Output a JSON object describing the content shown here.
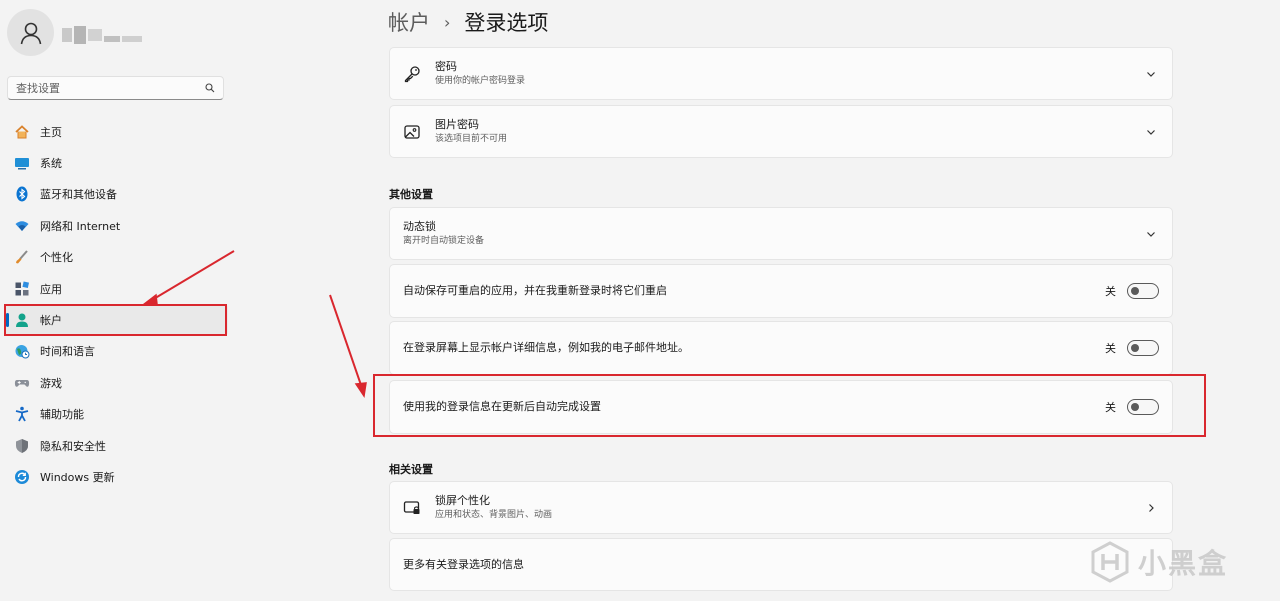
{
  "sidebar": {
    "search": {
      "placeholder": "查找设置"
    },
    "items": [
      {
        "label": "主页",
        "icon": "home-icon"
      },
      {
        "label": "系统",
        "icon": "system-icon"
      },
      {
        "label": "蓝牙和其他设备",
        "icon": "bluetooth-icon"
      },
      {
        "label": "网络和 Internet",
        "icon": "wifi-icon"
      },
      {
        "label": "个性化",
        "icon": "brush-icon"
      },
      {
        "label": "应用",
        "icon": "apps-icon"
      },
      {
        "label": "帐户",
        "icon": "account-icon",
        "active": true
      },
      {
        "label": "时间和语言",
        "icon": "globe-clock-icon"
      },
      {
        "label": "游戏",
        "icon": "gamepad-icon"
      },
      {
        "label": "辅助功能",
        "icon": "accessibility-icon"
      },
      {
        "label": "隐私和安全性",
        "icon": "shield-icon"
      },
      {
        "label": "Windows 更新",
        "icon": "update-icon"
      }
    ]
  },
  "breadcrumb": {
    "parent": "帐户",
    "current": "登录选项"
  },
  "cards": {
    "password": {
      "title": "密码",
      "subtitle": "使用你的帐户密码登录"
    },
    "picture_password": {
      "title": "图片密码",
      "subtitle": "该选项目前不可用"
    }
  },
  "other_settings": {
    "header": "其他设置",
    "dynamic_lock": {
      "title": "动态锁",
      "subtitle": "离开时自动锁定设备"
    },
    "toggles": [
      {
        "label": "自动保存可重启的应用，并在我重新登录时将它们重启",
        "state": "关"
      },
      {
        "label": "在登录屏幕上显示帐户详细信息，例如我的电子邮件地址。",
        "state": "关"
      },
      {
        "label": "使用我的登录信息在更新后自动完成设置",
        "state": "关"
      }
    ]
  },
  "related_settings": {
    "header": "相关设置",
    "lock_screen": {
      "title": "锁屏个性化",
      "subtitle": "应用和状态、背景图片、动画"
    },
    "more_info": {
      "title": "更多有关登录选项的信息"
    }
  },
  "watermark": {
    "text": "小黑盒"
  },
  "colors": {
    "accent": "#0067c0",
    "annotation": "#d9272e"
  }
}
